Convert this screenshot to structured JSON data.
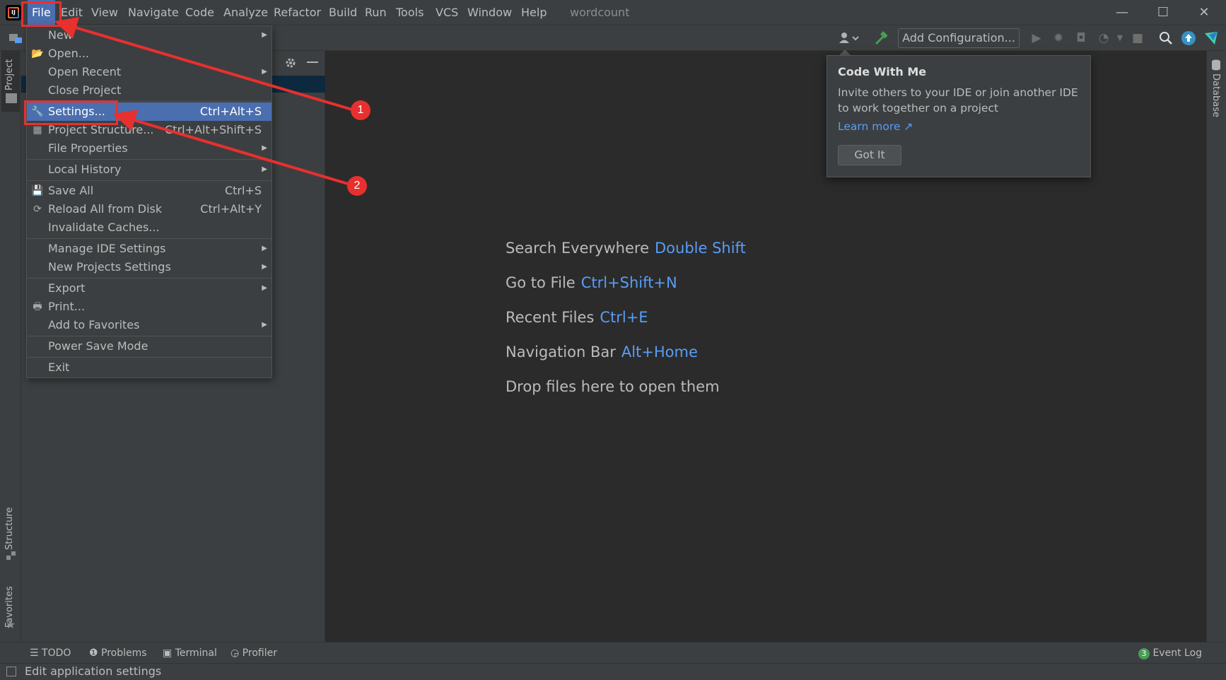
{
  "window": {
    "title": "wordcount",
    "minimize": "—",
    "maximize": "☐",
    "close": "✕"
  },
  "menubar": {
    "items": [
      "File",
      "Edit",
      "View",
      "Navigate",
      "Code",
      "Analyze",
      "Refactor",
      "Build",
      "Run",
      "Tools",
      "VCS",
      "Window",
      "Help"
    ],
    "active": "File"
  },
  "toolbar": {
    "add_configuration": "Add Configuration..."
  },
  "left_strip": {
    "project": "Project",
    "structure": "Structure",
    "favorites": "Favorites"
  },
  "right_strip": {
    "database": "Database"
  },
  "file_menu": {
    "new": "New",
    "open": "Open...",
    "open_recent": "Open Recent",
    "close_project": "Close Project",
    "settings": "Settings...",
    "settings_shortcut": "Ctrl+Alt+S",
    "project_structure": "Project Structure...",
    "project_structure_shortcut": "Ctrl+Alt+Shift+S",
    "file_properties": "File Properties",
    "local_history": "Local History",
    "save_all": "Save All",
    "save_all_shortcut": "Ctrl+S",
    "reload_all": "Reload All from Disk",
    "reload_all_shortcut": "Ctrl+Alt+Y",
    "invalidate_caches": "Invalidate Caches...",
    "manage_ide_settings": "Manage IDE Settings",
    "new_projects_settings": "New Projects Settings",
    "export": "Export",
    "print": "Print...",
    "add_to_favorites": "Add to Favorites",
    "power_save_mode": "Power Save Mode",
    "exit": "Exit"
  },
  "editor_hints": {
    "search_everywhere": "Search Everywhere",
    "search_everywhere_key": "Double Shift",
    "go_to_file": "Go to File",
    "go_to_file_key": "Ctrl+Shift+N",
    "recent_files": "Recent Files",
    "recent_files_key": "Ctrl+E",
    "navigation_bar": "Navigation Bar",
    "navigation_bar_key": "Alt+Home",
    "drop_files": "Drop files here to open them"
  },
  "code_with_me": {
    "title": "Code With Me",
    "body": "Invite others to your IDE or join another IDE to work together on a project",
    "link": "Learn more ↗",
    "button": "Got It"
  },
  "bottom_bar": {
    "todo": "TODO",
    "problems": "Problems",
    "terminal": "Terminal",
    "profiler": "Profiler",
    "event_log": "Event Log",
    "event_log_count": "3"
  },
  "status_bar": {
    "text": "Edit application settings"
  },
  "annotations": {
    "badge_1": "1",
    "badge_2": "2",
    "color": "#e8302e"
  },
  "colors": {
    "accent_selection": "#4b6eaf",
    "link": "#589df6",
    "background": "#2b2b2b",
    "panel": "#3c3f41"
  }
}
